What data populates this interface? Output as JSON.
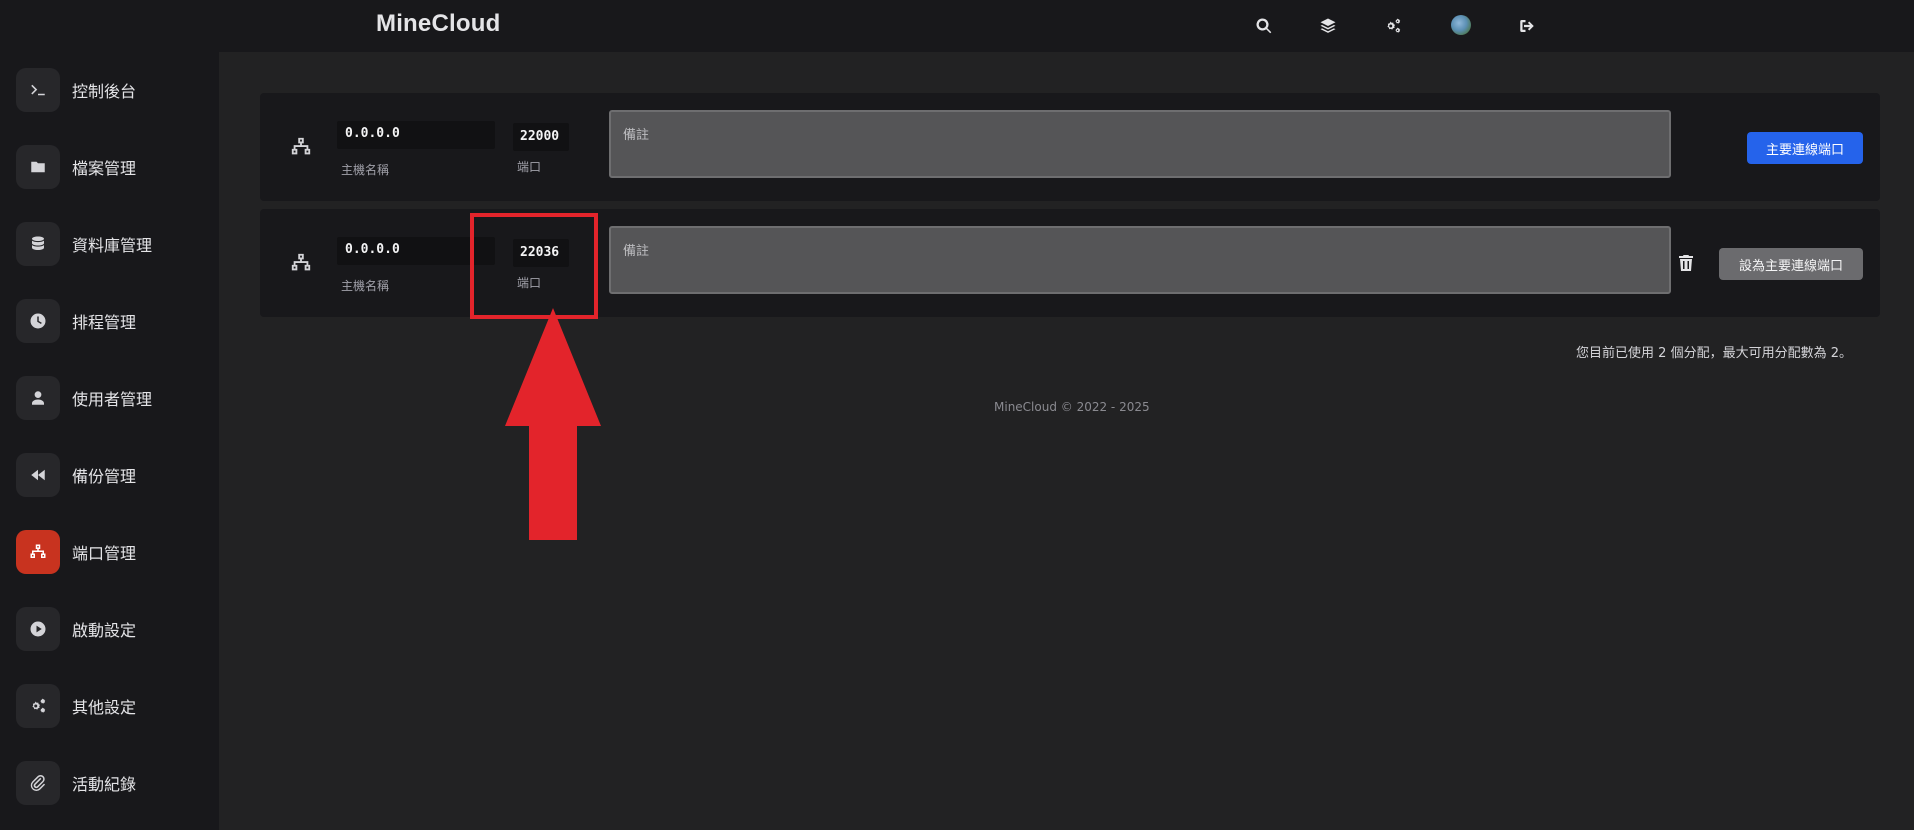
{
  "app": {
    "brand": "MineCloud"
  },
  "topbar": {
    "icons": [
      "search-icon",
      "layers-icon",
      "cogs-icon",
      "avatar",
      "logout-icon"
    ]
  },
  "sidebar": {
    "items": [
      {
        "label": "控制後台",
        "icon": "terminal-icon"
      },
      {
        "label": "檔案管理",
        "icon": "folder-icon"
      },
      {
        "label": "資料庫管理",
        "icon": "database-icon"
      },
      {
        "label": "排程管理",
        "icon": "clock-icon"
      },
      {
        "label": "使用者管理",
        "icon": "user-icon"
      },
      {
        "label": "備份管理",
        "icon": "backward-icon"
      },
      {
        "label": "端口管理",
        "icon": "network-icon",
        "active": true
      },
      {
        "label": "啟動設定",
        "icon": "play-icon"
      },
      {
        "label": "其他設定",
        "icon": "cogs-icon"
      },
      {
        "label": "活動紀錄",
        "icon": "paperclip-icon"
      }
    ],
    "active_color": "#c8331f"
  },
  "allocations": [
    {
      "host": "0.0.0.0",
      "host_caption": "主機名稱",
      "port": "22000",
      "port_caption": "端口",
      "note_placeholder": "備註",
      "button_label": "主要連線端口",
      "primary": true
    },
    {
      "host": "0.0.0.0",
      "host_caption": "主機名稱",
      "port": "22036",
      "port_caption": "端口",
      "note_placeholder": "備註",
      "button_label": "設為主要連線端口",
      "primary": false
    }
  ],
  "usage_text": "您目前已使用 2 個分配，最大可用分配數為 2。",
  "footer": "MineCloud © 2022 - 2025",
  "colors": {
    "primary_button": "#2563eb",
    "annotation": "#e3242b"
  }
}
